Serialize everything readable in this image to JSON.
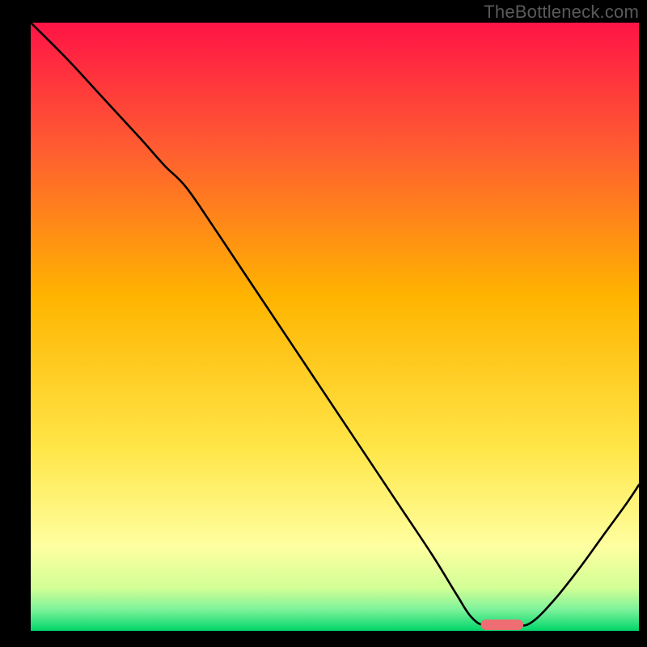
{
  "watermark": "TheBottleneck.com",
  "chart_data": {
    "type": "line",
    "title": "",
    "xlabel": "",
    "ylabel": "",
    "xlim": [
      0,
      100
    ],
    "ylim": [
      0,
      100
    ],
    "background_gradient": {
      "top": "#FF1446",
      "upper_mid": "#FF7A2A",
      "mid": "#FFD200",
      "lower_mid": "#FFFF8C",
      "bottom": "#00D66A",
      "stops": [
        {
          "pos": 0.0,
          "color": "#FF1446"
        },
        {
          "pos": 0.2,
          "color": "#FF5A32"
        },
        {
          "pos": 0.45,
          "color": "#FFB400"
        },
        {
          "pos": 0.7,
          "color": "#FFE648"
        },
        {
          "pos": 0.86,
          "color": "#FFFFA0"
        },
        {
          "pos": 0.93,
          "color": "#D2FF96"
        },
        {
          "pos": 0.965,
          "color": "#7DF29B"
        },
        {
          "pos": 1.0,
          "color": "#00D66A"
        }
      ]
    },
    "series": [
      {
        "name": "curve",
        "x": [
          0.0,
          6.0,
          12.0,
          18.0,
          22.0,
          25.5,
          30.0,
          36.0,
          44.0,
          52.0,
          60.0,
          66.0,
          70.0,
          72.5,
          75.0,
          80.0,
          82.5,
          86.0,
          90.0,
          94.0,
          98.0,
          100.0
        ],
        "y": [
          100.0,
          94.0,
          87.5,
          81.0,
          76.5,
          73.0,
          66.5,
          57.5,
          45.5,
          33.5,
          21.5,
          12.5,
          6.0,
          2.2,
          0.8,
          0.8,
          1.5,
          5.0,
          10.0,
          15.5,
          21.0,
          24.0
        ]
      },
      {
        "name": "marker-segment",
        "kind": "segment",
        "x": [
          74.0,
          81.0
        ],
        "y": [
          1.0,
          1.0
        ]
      }
    ],
    "marker_color": "#EE6E73",
    "flat_region": {
      "x_start": 72.5,
      "x_end": 80.0,
      "y": 0.8
    }
  }
}
